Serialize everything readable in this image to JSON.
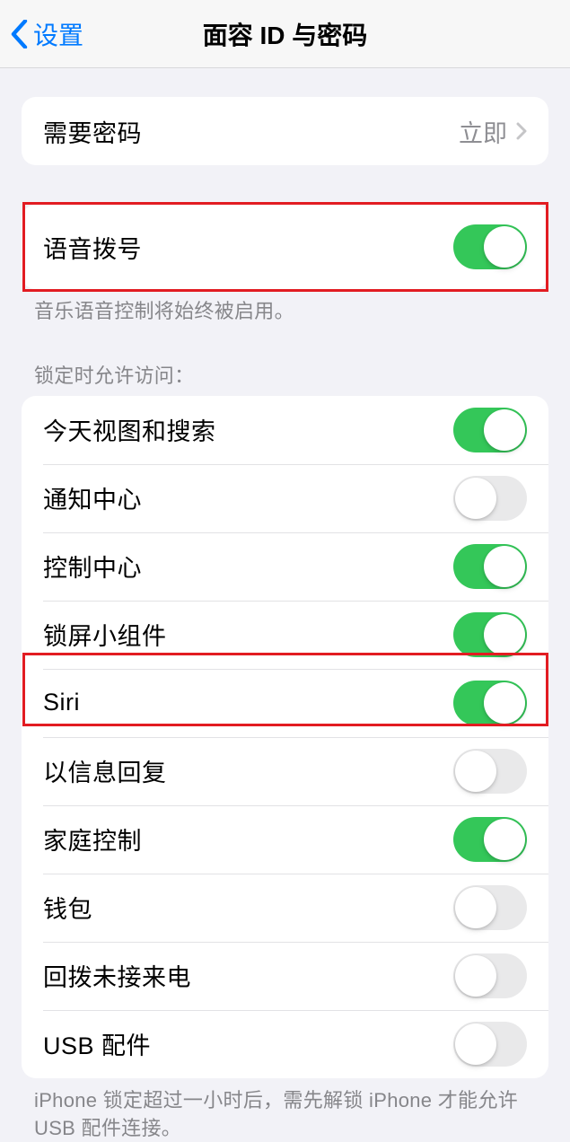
{
  "nav": {
    "back_label": "设置",
    "title": "面容 ID 与密码"
  },
  "require_passcode": {
    "label": "需要密码",
    "value": "立即"
  },
  "voice_dial": {
    "label": "语音拨号",
    "on": true
  },
  "voice_dial_footer": "音乐语音控制将始终被启用。",
  "lock_access_header": "锁定时允许访问：",
  "lock_access_items": [
    {
      "label": "今天视图和搜索",
      "on": true
    },
    {
      "label": "通知中心",
      "on": false
    },
    {
      "label": "控制中心",
      "on": true
    },
    {
      "label": "锁屏小组件",
      "on": true
    },
    {
      "label": "Siri",
      "on": true
    },
    {
      "label": "以信息回复",
      "on": false
    },
    {
      "label": "家庭控制",
      "on": true
    },
    {
      "label": "钱包",
      "on": false
    },
    {
      "label": "回拨未接来电",
      "on": false
    },
    {
      "label": "USB 配件",
      "on": false
    }
  ],
  "usb_footer": "iPhone 锁定超过一小时后，需先解锁 iPhone 才能允许USB 配件连接。"
}
